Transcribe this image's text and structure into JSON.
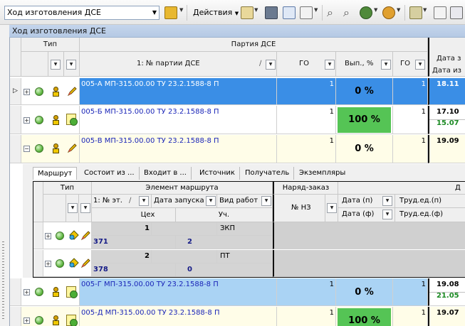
{
  "toolbar": {
    "view_selector": "Ход изготовления ДСЕ",
    "actions_label": "Действия"
  },
  "window_title": "Ход изготовления ДСЕ",
  "grid": {
    "group_type": "Тип",
    "group_batch": "Партия ДСЕ",
    "col_batch_no": "1: № партии ДСЕ",
    "col_go": "ГО",
    "col_done": "Вып., %",
    "col_go2": "ГО",
    "col_date_trunc": "Дата з",
    "col_date2_trunc": "Дата из"
  },
  "rows": [
    {
      "name": "005-А МП-315.00.00 ТУ 23.2.1588-8 П",
      "go": "1",
      "pct": "0 %",
      "go2": "1",
      "date1": "18.11",
      "date2": ""
    },
    {
      "name": "005-Б МП-315.00.00 ТУ 23.2.1588-8 П",
      "go": "1",
      "pct": "100 %",
      "go2": "1",
      "date1": "17.10",
      "date2": "15.07"
    },
    {
      "name": "005-В МП-315.00.00 ТУ 23.2.1588-8 П",
      "go": "1",
      "pct": "0 %",
      "go2": "1",
      "date1": "19.09",
      "date2": ""
    },
    {
      "name": "005-Г МП-315.00.00 ТУ 23.2.1588-8 П",
      "go": "1",
      "pct": "0 %",
      "go2": "1",
      "date1": "19.08",
      "date2": "21.05"
    },
    {
      "name": "005-Д МП-315.00.00 ТУ 23.2.1588-8 П",
      "go": "1",
      "pct": "100 %",
      "go2": "1",
      "date1": "19.07",
      "date2": ""
    }
  ],
  "detail_tabs": [
    "Маршрут",
    "Состоит из ...",
    "Входит в ...",
    "Источник",
    "Получатель",
    "Экземпляры"
  ],
  "detail": {
    "group_type": "Тип",
    "group_route": "Элемент маршрута",
    "group_order": "Наряд-заказ",
    "group_d_trunc": "Д",
    "col_step": "1: № эт.",
    "col_start_date": "Дата запуска",
    "col_work_type": "Вид работ",
    "col_shop": "Цех",
    "col_section": "Уч.",
    "col_order_no": "№ НЗ",
    "col_date_plan": "Дата (п)",
    "col_date_fact": "Дата (ф)",
    "col_labor_plan": "Труд.ед.(п)",
    "col_labor_fact": "Труд.ед.(ф)",
    "steps": [
      {
        "no": "1",
        "work": "ЗКП",
        "shop": "371",
        "section": "2"
      },
      {
        "no": "2",
        "work": "ПТ",
        "shop": "378",
        "section": "0"
      }
    ]
  },
  "colors": {
    "selection": "#3a8ee6",
    "complete": "#55c455",
    "title_bar": "#c4d5ec"
  }
}
